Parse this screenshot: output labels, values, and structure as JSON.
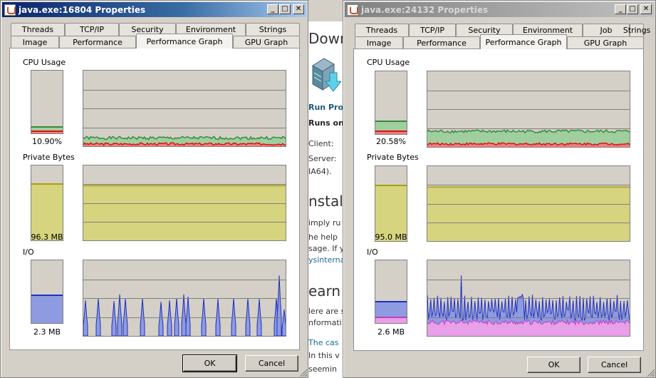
{
  "background_page": {
    "heading_download": "Down",
    "run_procmon": "Run Proc",
    "runs_on": "Runs on:",
    "client": "Client: ",
    "server": "Server:",
    "ia64": "IA64).",
    "heading_install": "nstall",
    "simply": "imply ru",
    "help1": "he help",
    "help2": "sage. If y",
    "link": "ysinterna",
    "heading_learn": "earn",
    "here": "lere are s",
    "info": "nformati",
    "case_link": "The cas",
    "in_this": "In this v",
    "seemin": "seemin"
  },
  "windows": [
    {
      "title": "java.exe:16804 Properties",
      "state": "active",
      "tabs_row1": [
        "Threads",
        "TCP/IP",
        "Security",
        "Environment",
        "Strings"
      ],
      "tabs_row2": [
        "Image",
        "Performance",
        "Performance Graph",
        "GPU Graph"
      ],
      "selected_tab": "Performance Graph",
      "sections": {
        "cpu": {
          "label": "CPU Usage",
          "value": "10.90%",
          "total_pct": 10.9,
          "kernel_pct": 3
        },
        "private_bytes": {
          "label": "Private Bytes",
          "value": "96.3 MB",
          "fill_pct": 75
        },
        "io": {
          "label": "I/O",
          "value": "2.3  MB",
          "fill_pct": 44,
          "other_pct": 0
        }
      },
      "buttons": {
        "ok": "OK",
        "cancel": "Cancel"
      }
    },
    {
      "title": "java.exe:24132 Properties",
      "state": "inactive",
      "tabs_row1": [
        "Threads",
        "TCP/IP",
        "Security",
        "Environment",
        "Job",
        "Strings"
      ],
      "tabs_row2": [
        "Image",
        "Performance",
        "Performance Graph",
        "GPU Graph"
      ],
      "selected_tab": "Performance Graph",
      "sections": {
        "cpu": {
          "label": "CPU Usage",
          "value": "20.58%",
          "total_pct": 20.6,
          "kernel_pct": 4
        },
        "private_bytes": {
          "label": "Private Bytes",
          "value": "95.0 MB",
          "fill_pct": 74
        },
        "io": {
          "label": "I/O",
          "value": "2.6  MB",
          "fill_pct": 34,
          "other_pct": 10
        }
      },
      "buttons": {
        "ok": "OK",
        "cancel": "Cancel"
      }
    }
  ],
  "title_buttons": {
    "minimize": "_",
    "maximize": "□",
    "close": "✕"
  },
  "colors": {
    "graph_bg": "#d4d0c8",
    "cpu_line": "#3a8a3a",
    "cpu_fill": "#9fcf9f",
    "kernel_line": "#e01010",
    "kernel_fill": "#f08080",
    "pb_line": "#a8a000",
    "pb_fill": "#d6d47e",
    "io_line": "#2030c0",
    "io_fill": "#8e9be0",
    "io_other_line": "#c040c0",
    "io_other_fill": "#e8a0e8"
  }
}
